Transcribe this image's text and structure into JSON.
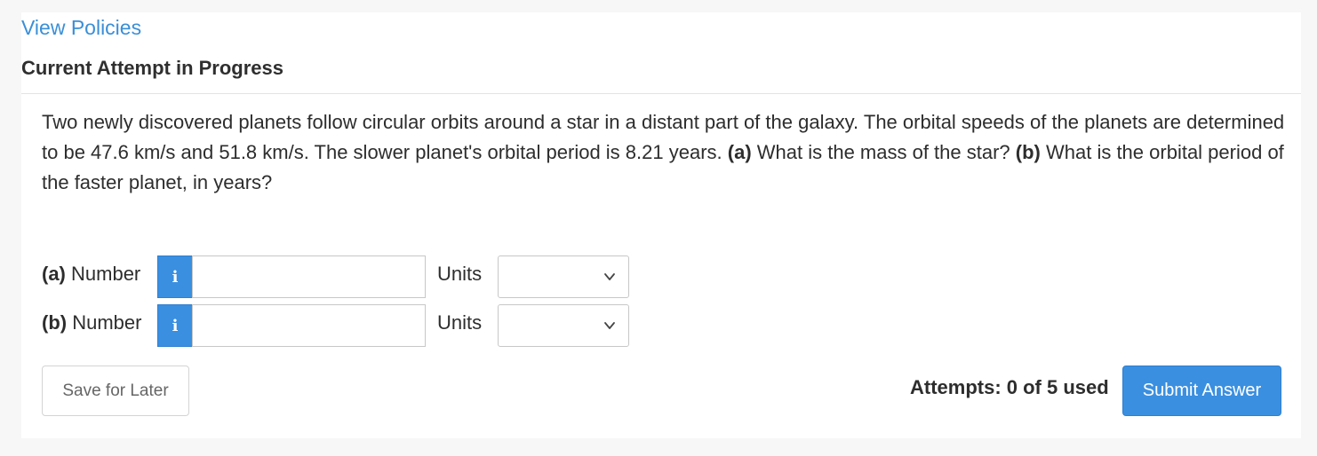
{
  "header": {
    "policies_link": "View Policies",
    "attempt_title": "Current Attempt in Progress"
  },
  "question": {
    "text_1": "Two newly discovered planets follow circular orbits around a star in a distant part of the galaxy. The orbital speeds of the planets are determined to be 47.6 km/s and 51.8 km/s. The slower planet's orbital period is 8.21 years. ",
    "part_a_marker": "(a)",
    "text_2": " What is the mass of the star? ",
    "part_b_marker": "(b)",
    "text_3": " What is the orbital period of the faster planet, in years?"
  },
  "answers": [
    {
      "marker": "(a)",
      "label": " Number",
      "info_glyph": "i",
      "value": "",
      "units_label": "Units",
      "units_selected": ""
    },
    {
      "marker": "(b)",
      "label": " Number",
      "info_glyph": "i",
      "value": "",
      "units_label": "Units",
      "units_selected": ""
    }
  ],
  "footer": {
    "save_label": "Save for Later",
    "attempts_text": "Attempts: 0 of 5 used",
    "submit_label": "Submit Answer"
  },
  "icons": {
    "info": "info-icon",
    "dropdown": "chevron-down-icon"
  },
  "colors": {
    "accent": "#3a8fe0",
    "link": "#3a8fd8",
    "background": "#f7f7f7",
    "panel": "#ffffff"
  }
}
